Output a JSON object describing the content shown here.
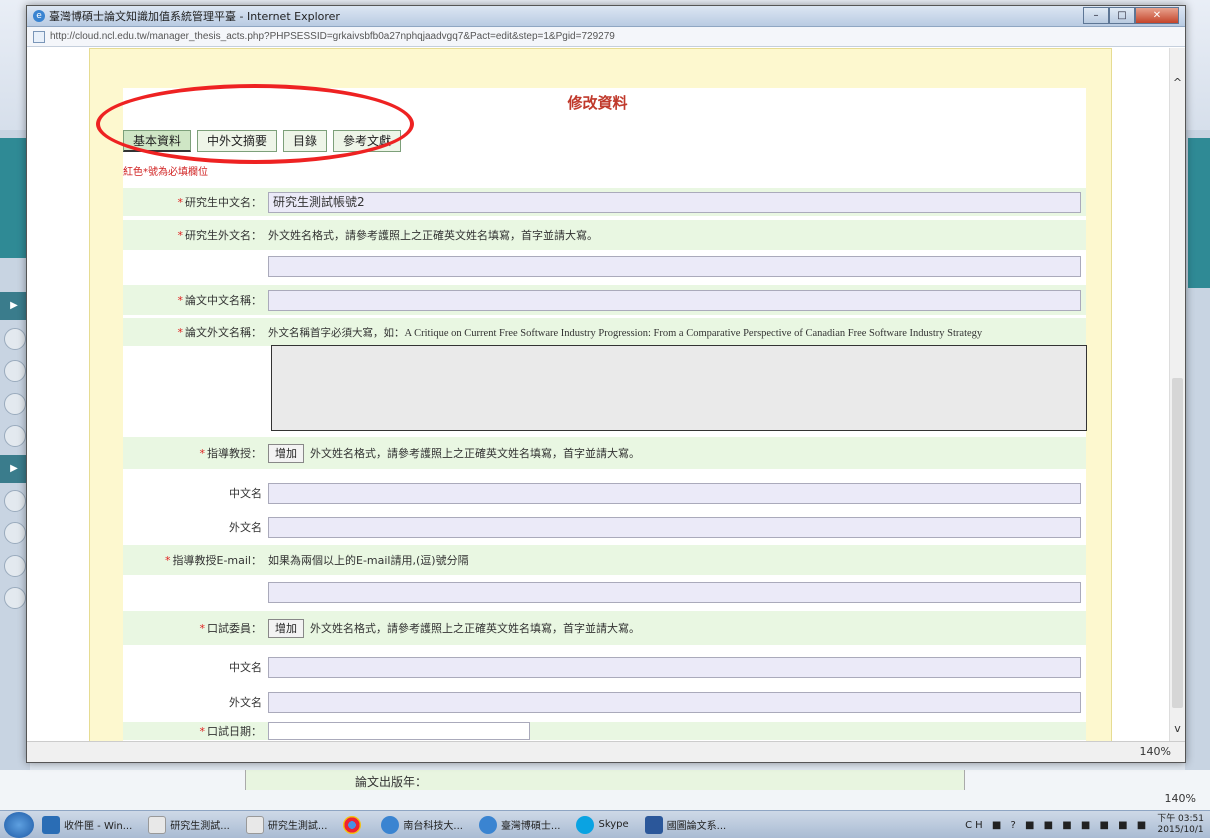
{
  "window": {
    "title": "臺灣博碩士論文知識加值系統管理平臺 - Internet Explorer",
    "url": "http://cloud.ncl.edu.tw/manager_thesis_acts.php?PHPSESSID=grkaivsbfb0a27nphqjaadvgq7&Pact=edit&step=1&Pgid=729279",
    "zoom": "140%"
  },
  "page": {
    "title": "修改資料",
    "tabs": [
      "基本資料",
      "中外文摘要",
      "目錄",
      "參考文獻"
    ],
    "required_hint": "紅色*號為必填欄位"
  },
  "form": {
    "student_cn_label": "研究生中文名：",
    "student_cn_value": "研究生測試帳號2",
    "student_en_label": "研究生外文名：",
    "student_en_hint": "外文姓名格式，請參考護照上之正確英文姓名填寫，首字並請大寫。",
    "thesis_cn_label": "論文中文名稱：",
    "thesis_en_label": "論文外文名稱：",
    "thesis_en_hint": "外文名稱首字必須大寫，如：A Critique on Current Free Software Industry Progression: From a Comparative Perspective of Canadian Free Software Industry Strategy",
    "advisor_label": "指導教授：",
    "add_button": "增加",
    "advisor_hint": "外文姓名格式，請參考護照上之正確英文姓名填寫，首字並請大寫。",
    "cn_name_label": "中文名",
    "en_name_label": "外文名",
    "advisor_email_label": "指導教授E-mail：",
    "advisor_email_hint": "如果為兩個以上的E-mail請用,(逗)號分隔",
    "committee_label": "口試委員：",
    "committee_hint": "外文姓名格式，請參考護照上之正確英文姓名填寫，首字並請大寫。",
    "exam_date_label": "口試日期："
  },
  "background": {
    "bottom_label": "論文出版年："
  },
  "taskbar": {
    "items": [
      "收件匣 - Win...",
      "研究生測試...",
      "研究生測試...",
      "",
      "南台科技大...",
      "臺灣博碩士...",
      "Skype",
      "國圖論文系..."
    ],
    "time": "下午 03:51",
    "date": "2015/10/1"
  }
}
